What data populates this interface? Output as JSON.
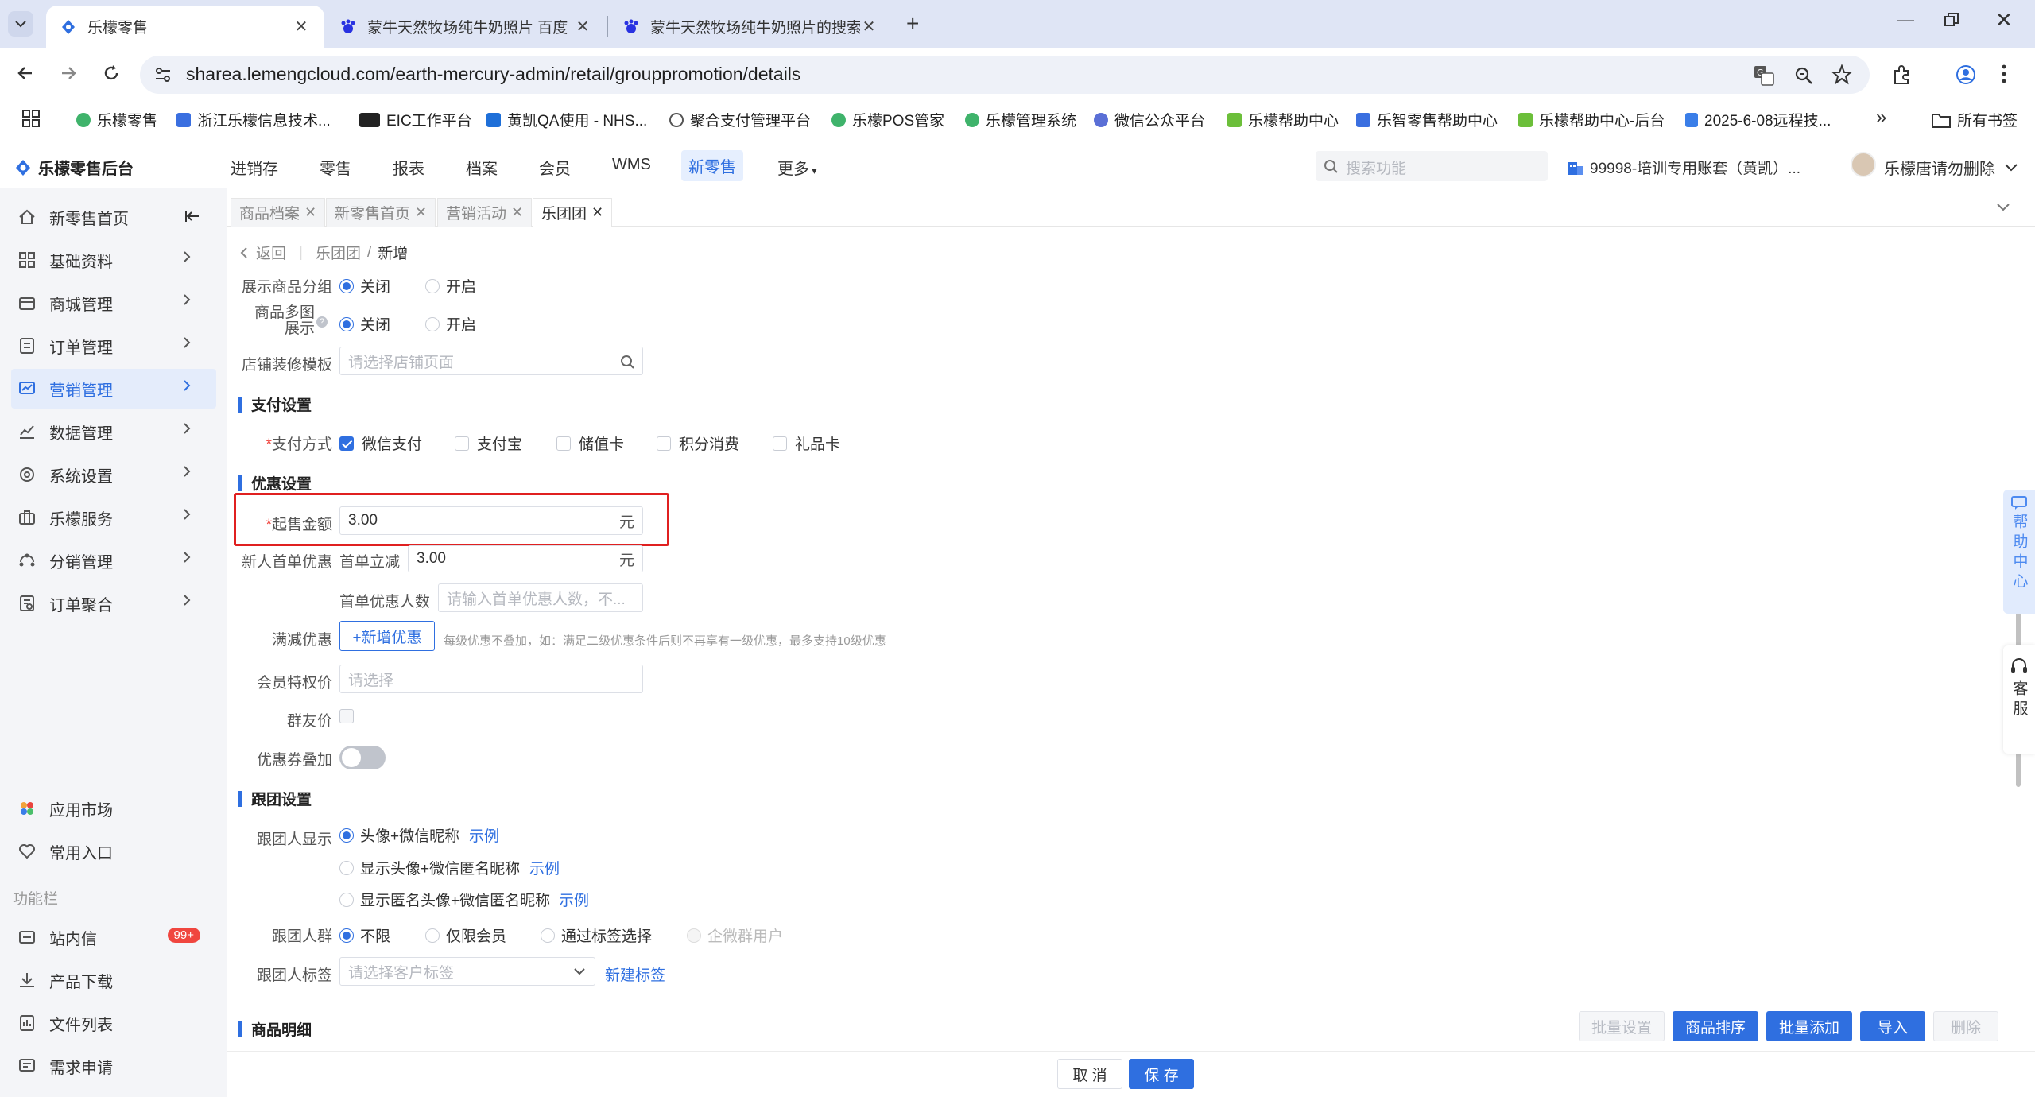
{
  "browser": {
    "tabs": [
      {
        "title": "乐檬零售",
        "active": true
      },
      {
        "title": "蒙牛天然牧场纯牛奶照片 百度",
        "active": false
      },
      {
        "title": "蒙牛天然牧场纯牛奶照片的搜索",
        "active": false
      }
    ],
    "url": "sharea.lemengcloud.com/earth-mercury-admin/retail/grouppromotion/details",
    "bookmarks": [
      "乐檬零售",
      "浙江乐檬信息技术...",
      "EIC工作平台",
      "黄凯QA使用 - NHS...",
      "聚合支付管理平台",
      "乐檬POS管家",
      "乐檬管理系统",
      "微信公众平台",
      "乐檬帮助中心",
      "乐智零售帮助中心",
      "乐檬帮助中心-后台",
      "2025-6-08远程技..."
    ],
    "all_bookmarks": "所有书签"
  },
  "app": {
    "logo": "乐檬零售后台",
    "nav": [
      "进销存",
      "零售",
      "报表",
      "档案",
      "会员",
      "WMS",
      "新零售",
      "更多"
    ],
    "active_nav": "新零售",
    "search_placeholder": "搜索功能",
    "account": "99998-培训专用账套（黄凯）...",
    "user": "乐檬唐请勿删除"
  },
  "sidebar": {
    "items": [
      {
        "label": "新零售首页",
        "icon": "home-icon"
      },
      {
        "label": "基础资料",
        "icon": "grid-icon"
      },
      {
        "label": "商城管理",
        "icon": "shop-icon"
      },
      {
        "label": "订单管理",
        "icon": "order-icon"
      },
      {
        "label": "营销管理",
        "icon": "marketing-icon",
        "active": true
      },
      {
        "label": "数据管理",
        "icon": "chart-icon"
      },
      {
        "label": "系统设置",
        "icon": "settings-icon"
      },
      {
        "label": "乐檬服务",
        "icon": "service-icon"
      },
      {
        "label": "分销管理",
        "icon": "distribution-icon"
      },
      {
        "label": "订单聚合",
        "icon": "aggregate-icon"
      }
    ],
    "bottom": [
      {
        "label": "应用市场",
        "icon": "apps-icon"
      },
      {
        "label": "常用入口",
        "icon": "heart-icon"
      }
    ],
    "section_label": "功能栏",
    "tools": [
      {
        "label": "站内信",
        "icon": "mail-icon",
        "badge": "99+"
      },
      {
        "label": "产品下载",
        "icon": "download-icon"
      },
      {
        "label": "文件列表",
        "icon": "file-icon"
      },
      {
        "label": "需求申请",
        "icon": "request-icon"
      }
    ]
  },
  "page_tabs": [
    "商品档案",
    "新零售首页",
    "营销活动",
    "乐团团"
  ],
  "breadcrumb": {
    "back": "返回",
    "parent": "乐团团",
    "current": "新增"
  },
  "form": {
    "show_group_label": "展示商品分组",
    "multi_image_label_1": "商品多图",
    "multi_image_label_2": "展示",
    "opt_off": "关闭",
    "opt_on": "开启",
    "template_label": "店铺装修模板",
    "template_placeholder": "请选择店铺页面",
    "payment_section": "支付设置",
    "payment_label": "支付方式",
    "payments": [
      "微信支付",
      "支付宝",
      "储值卡",
      "积分消费",
      "礼品卡"
    ],
    "discount_section": "优惠设置",
    "min_amount_label": "起售金额",
    "min_amount_value": "3.00",
    "unit": "元",
    "newbie_label": "新人首单优惠",
    "first_cut_label": "首单立减",
    "first_cut_value": "3.00",
    "first_count_label": "首单优惠人数",
    "first_count_placeholder": "请输入首单优惠人数，不...",
    "full_reduce_label": "满减优惠",
    "add_discount_button": "+新增优惠",
    "full_reduce_hint": "每级优惠不叠加，如：满足二级优惠条件后则不再享有一级优惠，最多支持10级优惠",
    "member_price_label": "会员特权价",
    "member_price_placeholder": "请选择",
    "friend_price_label": "群友价",
    "coupon_stack_label": "优惠券叠加",
    "follow_section": "跟团设置",
    "follower_display_label": "跟团人显示",
    "follower_options": [
      "头像+微信昵称",
      "显示头像+微信匿名昵称",
      "显示匿名头像+微信匿名昵称"
    ],
    "example": "示例",
    "follower_group_label": "跟团人群",
    "group_options": [
      "不限",
      "仅限会员",
      "通过标签选择",
      "企微群用户"
    ],
    "follower_tag_label": "跟团人标签",
    "tag_placeholder": "请选择客户标签",
    "new_tag_link": "新建标签",
    "goods_section": "商品明细",
    "goods_buttons": [
      "批量设置",
      "商品排序",
      "批量添加",
      "导入",
      "删除"
    ]
  },
  "footer": {
    "cancel": "取 消",
    "save": "保 存"
  },
  "float": {
    "help": "帮助中心",
    "service": "客服"
  },
  "colors": {
    "accent": "#2f6fe0",
    "highlight": "#e02020",
    "badge": "#f0463f"
  }
}
